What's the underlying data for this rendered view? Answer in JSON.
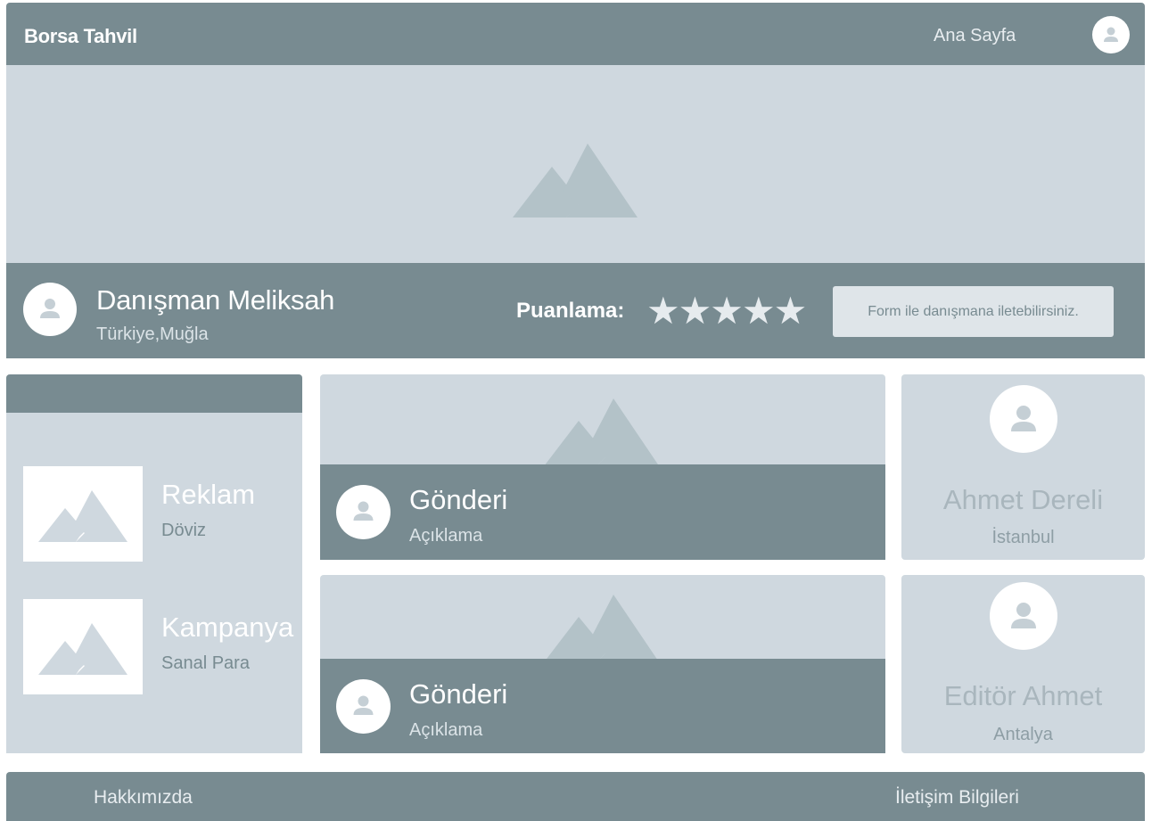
{
  "header": {
    "brand": "Borsa Tahvil",
    "nav_home": "Ana Sayfa",
    "user_icon": "user-icon"
  },
  "hero": {
    "image_icon": "image-placeholder-icon"
  },
  "profile": {
    "name": "Danışman Meliksah",
    "location": "Türkiye,Muğla",
    "rating_label": "Puanlama:",
    "stars": "★★★★★",
    "rating": 5,
    "contact_button": "Form ile danışmana iletebilirsiniz."
  },
  "sidebar": {
    "items": [
      {
        "title": "Reklam",
        "subtitle": "Döviz"
      },
      {
        "title": "Kampanya",
        "subtitle": "Sanal Para"
      }
    ]
  },
  "posts": [
    {
      "title": "Gönderi",
      "description": "Açıklama"
    },
    {
      "title": "Gönderi",
      "description": "Açıklama"
    }
  ],
  "people": [
    {
      "name": "Ahmet Dereli",
      "city": "İstanbul"
    },
    {
      "name": "Editör Ahmet",
      "city": "Antalya"
    }
  ],
  "footer": {
    "about": "Hakkımızda",
    "contact": "İletişim Bilgileri"
  },
  "colors": {
    "bar": "#788b91",
    "panel": "#cfd8df",
    "image": "#b3c2c8",
    "white": "#ffffff"
  }
}
